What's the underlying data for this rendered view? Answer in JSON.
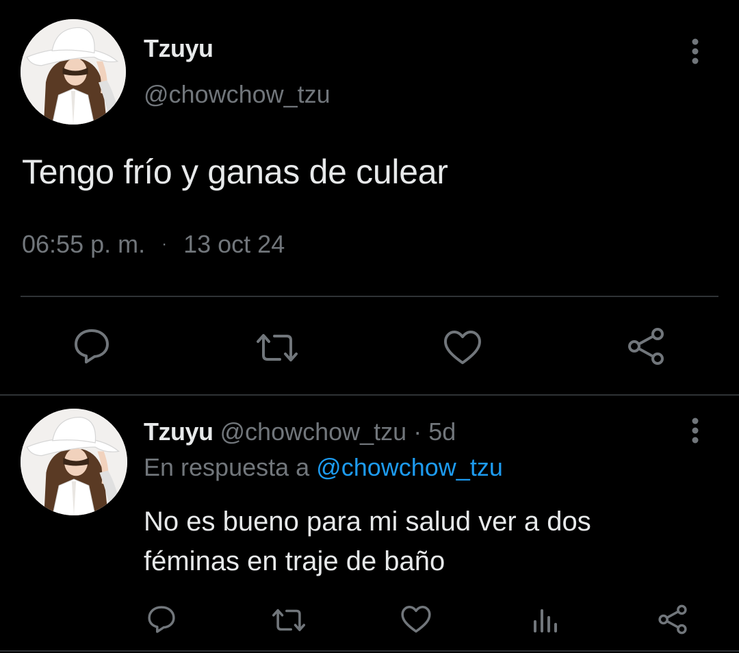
{
  "main_tweet": {
    "author_name": "Tzuyu",
    "author_handle": "@chowchow_tzu",
    "text": "Tengo frío y ganas de culear",
    "time": "06:55 p. m.",
    "separator": "·",
    "date": "13 oct 24",
    "more_icon": "more-vertical-icon",
    "actions": [
      "reply-icon",
      "retweet-icon",
      "like-icon",
      "share-icon"
    ]
  },
  "reply_tweet": {
    "author_name": "Tzuyu",
    "author_handle": "@chowchow_tzu",
    "separator": "·",
    "age": "5d",
    "reply_prefix": "En respuesta a",
    "reply_mention": "@chowchow_tzu",
    "text": "No es bueno para mi salud ver a dos féminas en traje de baño",
    "more_icon": "more-vertical-icon",
    "actions": [
      "reply-icon",
      "retweet-icon",
      "like-icon",
      "views-icon",
      "share-icon"
    ]
  },
  "colors": {
    "background": "#000000",
    "primary_text": "#e7e9ea",
    "secondary_text": "#71767b",
    "link": "#1d9bf0",
    "divider": "#2f3336"
  }
}
